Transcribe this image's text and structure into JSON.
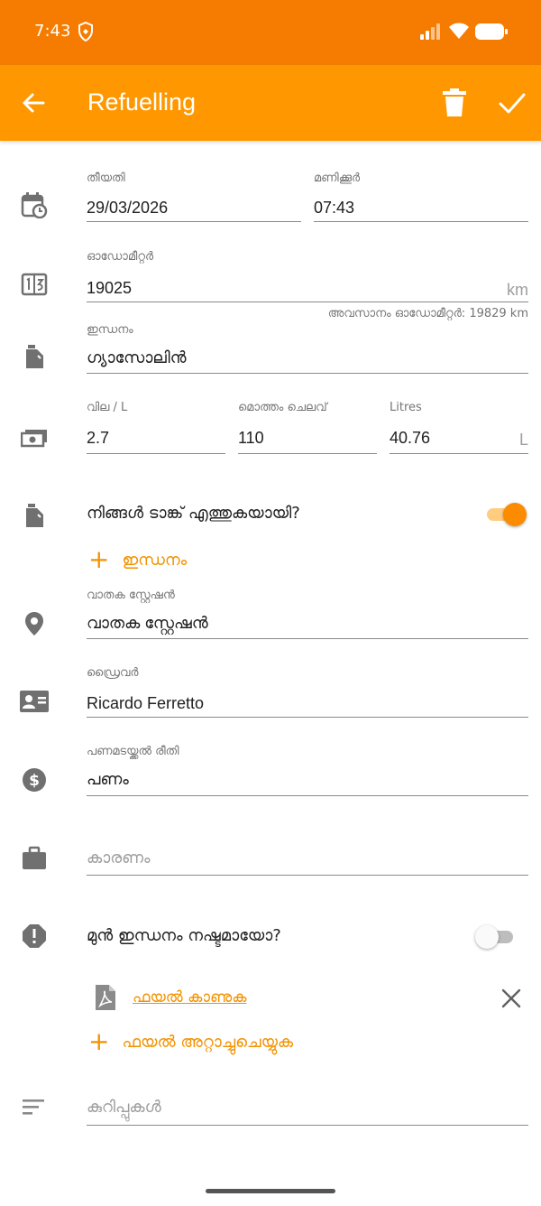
{
  "status_bar": {
    "time": "7:43"
  },
  "app_bar": {
    "title": "Refuelling",
    "back_icon": "arrow-left-icon",
    "delete_icon": "trash-icon",
    "save_icon": "check-icon",
    "background": "#FF9800",
    "status_background": "#F57C00"
  },
  "date": {
    "label": "തീയതി",
    "value": "29/03/2026"
  },
  "time": {
    "label": "മണിക്കൂർ",
    "value": "07:43"
  },
  "odometer": {
    "label": "ഓഡോമീറ്റർ",
    "value": "19025",
    "unit": "km",
    "helper": "അവസാനം ഓഡോമീറ്റർ: 19829 km"
  },
  "fuel": {
    "label": "ഇന്ധനം",
    "value": "ഗ്യാസോലിൻ"
  },
  "price": {
    "label": "വില / L",
    "value": "2.7"
  },
  "total_cost": {
    "label": "മൊത്തം ചെലവ്",
    "value": "110"
  },
  "litres": {
    "label": "Litres",
    "value": "40.76",
    "unit": "L"
  },
  "full_tank": {
    "label": "നിങ്ങൾ ടാങ്ക് എത്തുകയായി?",
    "checked": true
  },
  "add_fuel": {
    "label": "ഇന്ധനം"
  },
  "gas_station": {
    "label": "വാതക സ്റ്റേഷൻ",
    "value": "വാതക സ്റ്റേഷൻ"
  },
  "driver": {
    "label": "ഡ്രൈവർ",
    "value": "Ricardo Ferretto"
  },
  "payment": {
    "label": "പണമടയ്ക്കൽ രീതി",
    "value": "പണം"
  },
  "reason": {
    "placeholder": "കാരണം"
  },
  "missed_fuel": {
    "label": "മുൻ ഇന്ധനം നഷ്ടമായോ?",
    "checked": false
  },
  "attachment": {
    "link": "ഫയൽ കാണുക",
    "icon": "pdf-icon"
  },
  "attach_file": {
    "label": "ഫയൽ അറ്റാച്ചുചെയ്യുക"
  },
  "notes": {
    "placeholder": "കുറിപ്പുകൾ"
  },
  "accent_color": "#F39200"
}
